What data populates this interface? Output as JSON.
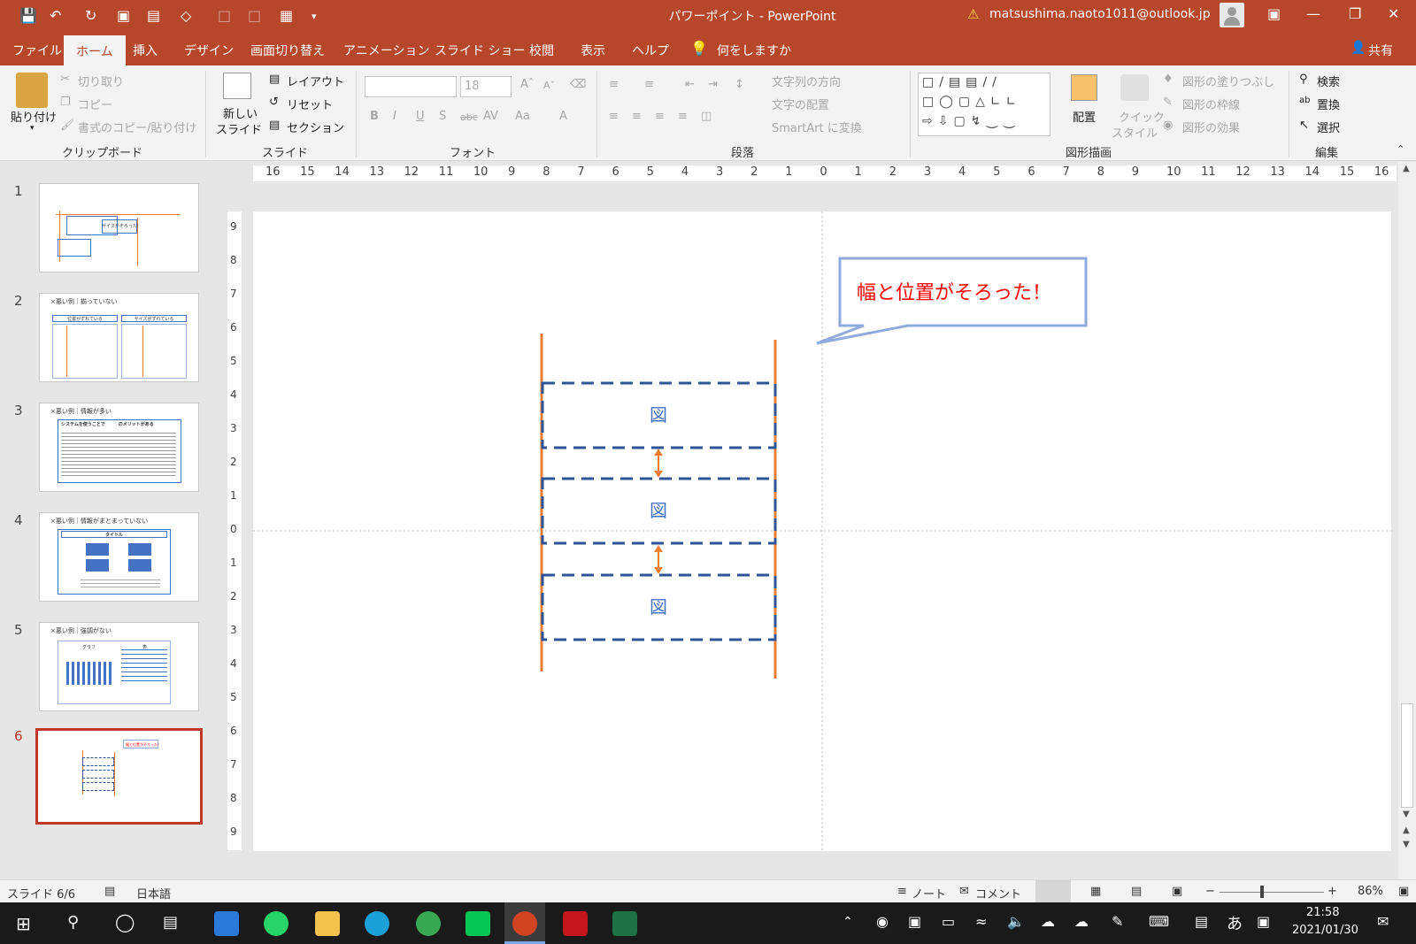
{
  "window": {
    "title": "パワーポイント  -  PowerPoint",
    "account": "matsushima.naoto1011@outlook.jp"
  },
  "tabs": [
    "ファイル",
    "ホーム",
    "挿入",
    "デザイン",
    "画面切り替え",
    "アニメーション",
    "スライド ショー",
    "校閲",
    "表示",
    "ヘルプ"
  ],
  "tell_me": "何をしますか",
  "share": "共有",
  "ribbon": {
    "clipboard": {
      "paste": "貼り付け",
      "cut": "切り取り",
      "copy": "コピー",
      "format_painter": "書式のコピー/貼り付け",
      "group": "クリップボード"
    },
    "slides": {
      "new_slide_1": "新しい",
      "new_slide_2": "スライド",
      "layout": "レイアウト",
      "reset": "リセット",
      "section": "セクション",
      "group": "スライド"
    },
    "font": {
      "size": "18",
      "group": "フォント"
    },
    "paragraph": {
      "text_direction": "文字列の方向",
      "align_text": "文字の配置",
      "smartart": "SmartArt に変換",
      "group": "段落"
    },
    "drawing": {
      "arrange": "配置",
      "quick_styles_1": "クイック",
      "quick_styles_2": "スタイル",
      "fill": "図形の塗りつぶし",
      "outline": "図形の枠線",
      "effects": "図形の効果",
      "group": "図形描画"
    },
    "editing": {
      "find": "検索",
      "replace": "置換",
      "select": "選択",
      "group": "編集"
    }
  },
  "thumbnails": [
    {
      "num": "1",
      "texts": [
        "サイズがそろった!",
        "図",
        "図",
        "図"
      ]
    },
    {
      "num": "2",
      "title": "×悪い例｜揃っていない",
      "labels": [
        "位置がずれている",
        "サイズがずれている"
      ]
    },
    {
      "num": "3",
      "title": "×悪い例｜情報が多い",
      "heading": "システムを使うことで　　　のメリットがある"
    },
    {
      "num": "4",
      "title": "×悪い例｜情報がまとまっていない",
      "heading": "タイトル"
    },
    {
      "num": "5",
      "title": "×悪い例｜強調がない",
      "labels": [
        "グラフ",
        "表"
      ]
    },
    {
      "num": "6",
      "texts": [
        "幅と位置がそろった！"
      ]
    }
  ],
  "ruler": {
    "h_ticks": [
      "16",
      "15",
      "14",
      "13",
      "12",
      "11",
      "10",
      "9",
      "8",
      "7",
      "6",
      "5",
      "4",
      "3",
      "2",
      "1",
      "0",
      "1",
      "2",
      "3",
      "4",
      "5",
      "6",
      "7",
      "8",
      "9",
      "10",
      "11",
      "12",
      "13",
      "14",
      "15",
      "16"
    ],
    "v_ticks": [
      "9",
      "8",
      "7",
      "6",
      "5",
      "4",
      "3",
      "2",
      "1",
      "0",
      "1",
      "2",
      "3",
      "4",
      "5",
      "6",
      "7",
      "8",
      "9"
    ]
  },
  "slide": {
    "callout": "幅と位置がそろった！",
    "box_label": "図",
    "colors": {
      "orange": "#ed7d31",
      "blue_dash": "#2e5496",
      "callout_border": "#8faadc",
      "callout_text": "#ff0000"
    }
  },
  "status": {
    "slide_info": "スライド 6/6",
    "language": "日本語",
    "notes": "ノート",
    "comments": "コメント",
    "zoom": "86%"
  },
  "taskbar": {
    "time": "21:58",
    "date": "2021/01/30",
    "ime": "あ"
  }
}
